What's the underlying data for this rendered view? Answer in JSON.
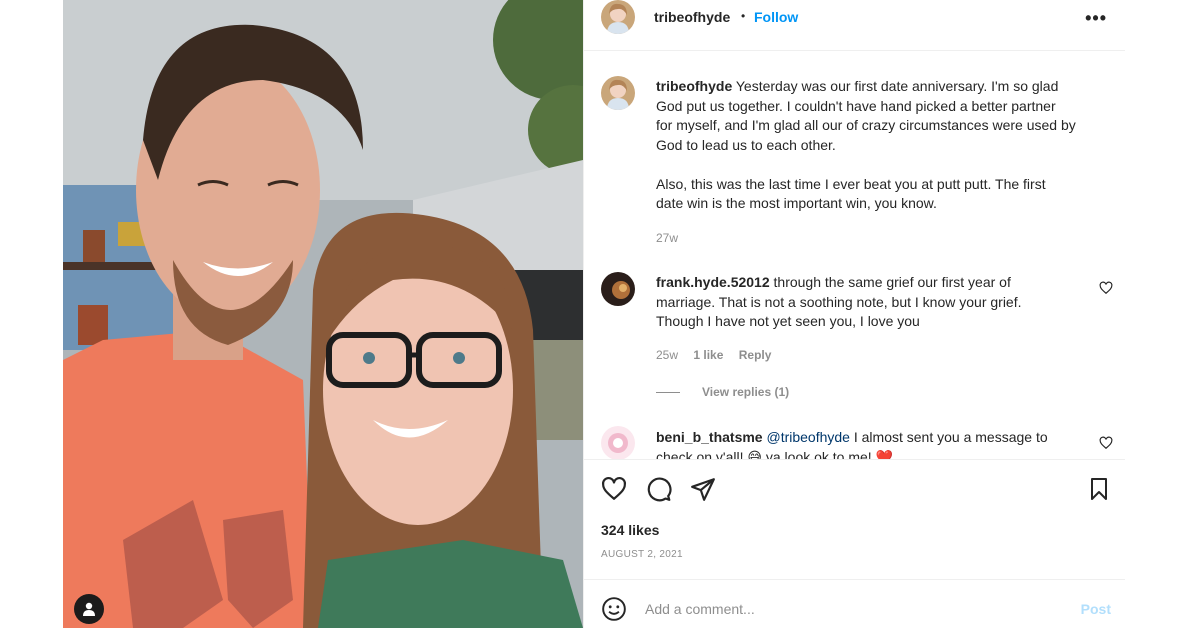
{
  "post": {
    "author": "tribeofhyde",
    "separator": "•",
    "follow_label": "Follow",
    "more_label": "•••",
    "likes": "324 likes",
    "date": "AUGUST 2, 2021"
  },
  "caption": {
    "username": "tribeofhyde",
    "lines": [
      "Yesterday was our first date anniversary. I'm so glad",
      "God put us together. I couldn't have hand picked a better partner",
      "for myself, and I'm glad all our of crazy circumstances were used by",
      "God to lead us to each other.",
      "",
      "Also, this was the last time I ever beat you at putt putt. The first",
      "date win is the most important win, you know."
    ],
    "time": "27w"
  },
  "comments": [
    {
      "username": "frank.hyde.52012",
      "lines": [
        "through the same grief our first year of",
        "marriage. That is not a soothing note, but I know your grief.",
        "Though I have not yet seen you, I love you"
      ],
      "time": "25w",
      "likes": "1 like",
      "reply_label": "Reply",
      "view_replies": "View replies (1)"
    },
    {
      "username": "beni_b_thatsme",
      "mention": "@tribeofhyde",
      "text": "I almost sent you a message to",
      "partial_line": "check on y'all! 😅 ya look ok to me! ❤️"
    }
  ],
  "add_comment": {
    "placeholder": "Add a comment...",
    "post_label": "Post"
  },
  "colors": {
    "link": "#0095f6",
    "muted": "#8e8e8e",
    "border": "#efefef"
  },
  "icons": [
    "user-tag-icon",
    "heart-icon",
    "comment-icon",
    "share-icon",
    "bookmark-icon",
    "emoji-icon"
  ]
}
